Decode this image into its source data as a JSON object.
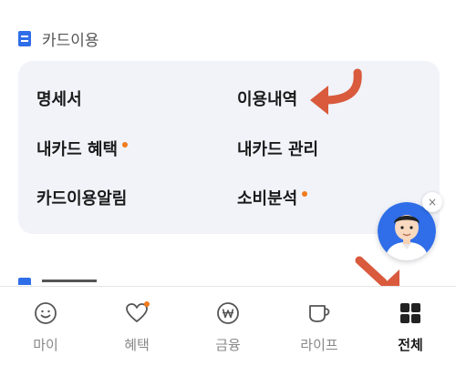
{
  "section": {
    "title": "카드이용",
    "icon": "document-icon"
  },
  "menu": [
    {
      "label": "명세서",
      "dot": false
    },
    {
      "label": "이용내역",
      "dot": false
    },
    {
      "label": "내카드 혜택",
      "dot": true
    },
    {
      "label": "내카드 관리",
      "dot": false
    },
    {
      "label": "카드이용알림",
      "dot": false
    },
    {
      "label": "소비분석",
      "dot": true
    }
  ],
  "next_section": {
    "icon": "document-icon"
  },
  "floating": {
    "avatar": "chatbot-avatar",
    "close_label": "×"
  },
  "bottom_nav": [
    {
      "label": "마이",
      "icon": "smile-icon",
      "active": false
    },
    {
      "label": "혜택",
      "icon": "heart-icon",
      "active": false,
      "badge": true
    },
    {
      "label": "금융",
      "icon": "won-icon",
      "active": false
    },
    {
      "label": "라이프",
      "icon": "cup-icon",
      "active": false
    },
    {
      "label": "전체",
      "icon": "grid-icon",
      "active": true
    }
  ],
  "colors": {
    "accent_blue": "#2f6ee8",
    "badge_orange": "#f07a1c",
    "arrow_red": "#d95a3c",
    "card_bg": "#f1f3f9"
  }
}
